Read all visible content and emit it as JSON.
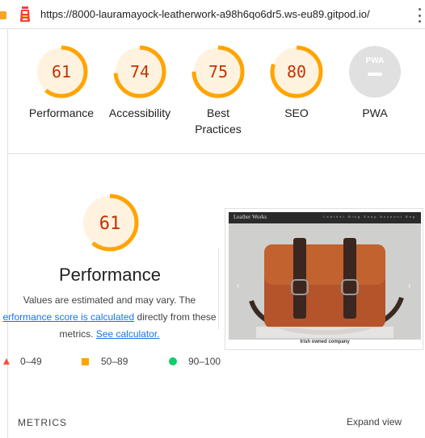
{
  "urlbar": {
    "url": "https://8000-lauramayock-leatherwork-a98h6qo6dr5.ws-eu89.gitpod.io/"
  },
  "gauges": [
    {
      "id": "performance",
      "score": "61",
      "label_line1": "Performance",
      "label_line2": ""
    },
    {
      "id": "accessibility",
      "score": "74",
      "label_line1": "Accessibility",
      "label_line2": ""
    },
    {
      "id": "best-practices",
      "score": "75",
      "label_line1": "Best",
      "label_line2": "Practices"
    },
    {
      "id": "seo",
      "score": "80",
      "label_line1": "SEO",
      "label_line2": ""
    },
    {
      "id": "pwa",
      "score": "",
      "label_line1": "PWA",
      "label_line2": ""
    }
  ],
  "pwa_badge": "PWA",
  "performance": {
    "score": "61",
    "title": "Performance",
    "desc_line1": "Values are estimated and may vary. The",
    "desc_link1": "erformance score is calculated",
    "desc_line2_rest": " directly from these",
    "desc_line3_pre": "metrics. ",
    "desc_link2": "See calculator."
  },
  "thumbnail": {
    "brand": "Leather Works",
    "nav": "Leather Blog Shop Account Bag",
    "caption": "Irish owned company"
  },
  "legend": [
    {
      "range": "0–49",
      "color": "#ff4e42",
      "shape": "triangle"
    },
    {
      "range": "50–89",
      "color": "#ffa400",
      "shape": "square"
    },
    {
      "range": "90–100",
      "color": "#0cce6b",
      "shape": "circle"
    }
  ],
  "footer": {
    "metrics_label": "METRICS",
    "expand_label": "Expand view"
  },
  "colors": {
    "average_stroke": "#ffa400",
    "average_fill": "#fff3e0",
    "average_text": "#c33300",
    "pwa_gray": "#e0e0e0"
  }
}
